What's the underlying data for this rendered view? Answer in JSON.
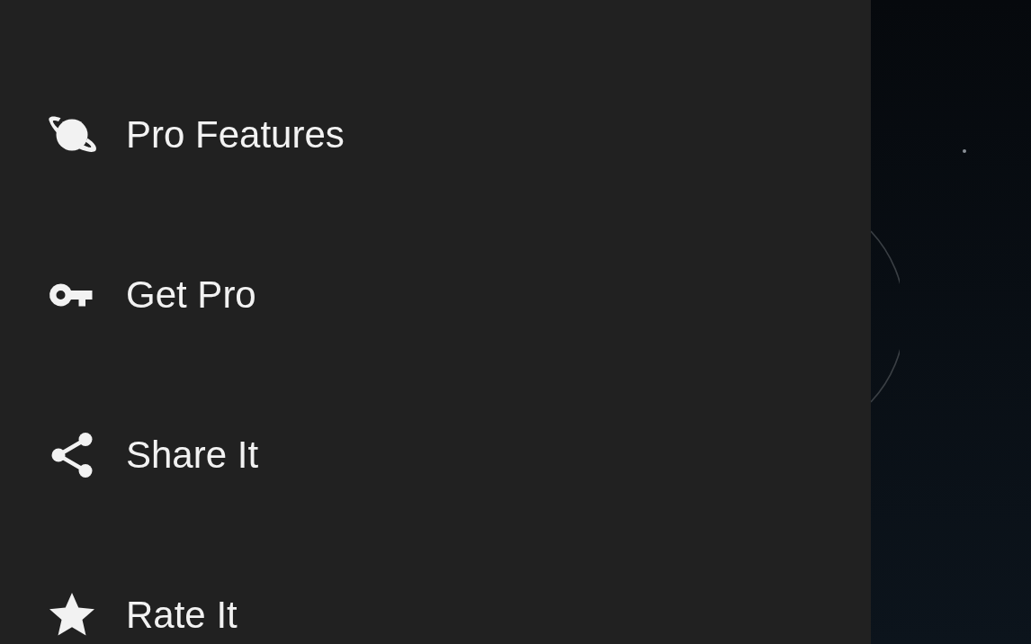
{
  "drawer": {
    "items": [
      {
        "kind": "planet",
        "label": "Pro Features"
      },
      {
        "kind": "key",
        "label": "Get Pro"
      },
      {
        "kind": "share",
        "label": "Share It"
      },
      {
        "kind": "star",
        "label": "Rate It"
      }
    ]
  }
}
